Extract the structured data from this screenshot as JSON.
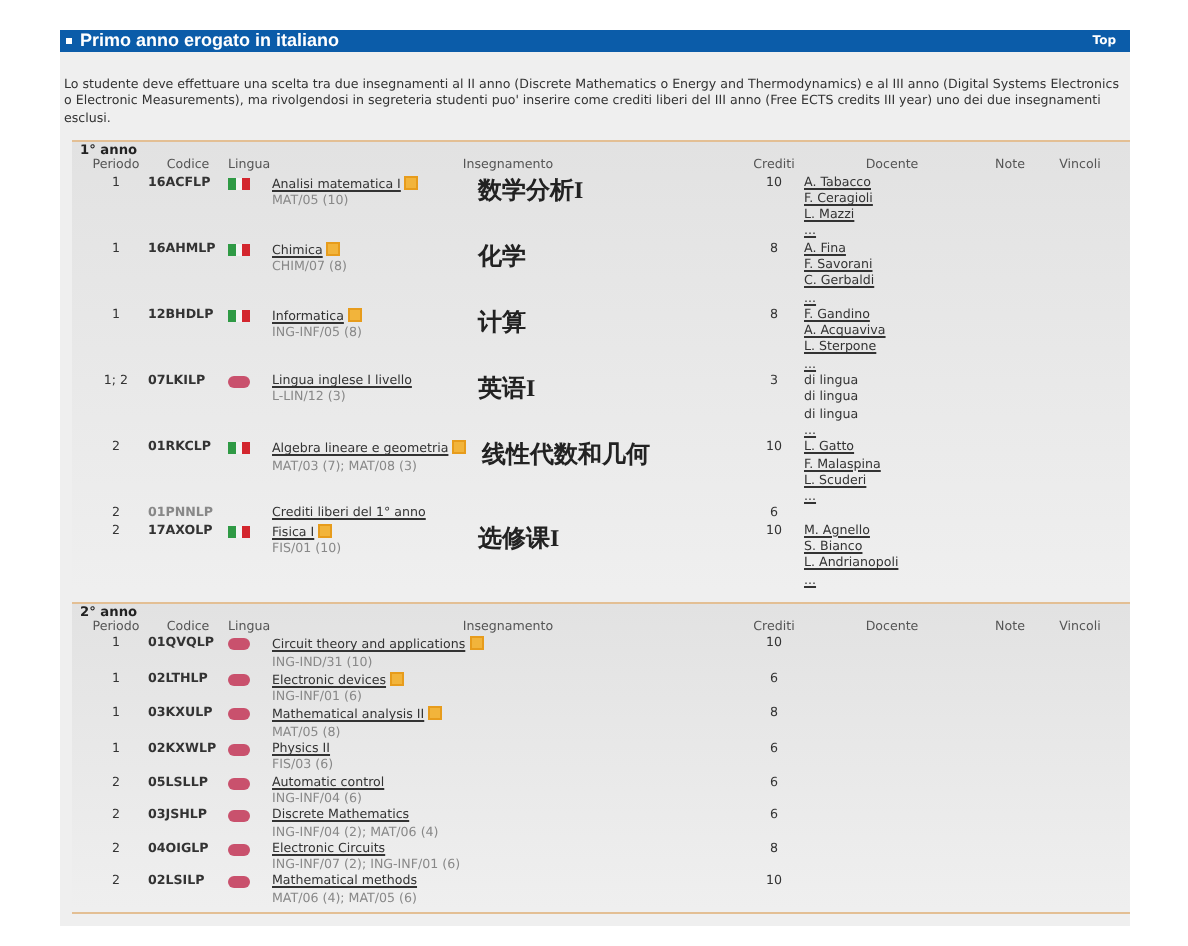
{
  "header": {
    "title": "Primo anno erogato in italiano",
    "top_link": "Top"
  },
  "intro": "Lo studente deve effettuare una scelta tra due insegnamenti al II anno (Discrete Mathematics o Energy and Thermodynamics) e al III anno (Digital Systems Electronics o Electronic Measurements), ma rivolgendosi in segreteria studenti puo' inserire come crediti liberi del III anno (Free ECTS credits III year) uno dei due insegnamenti esclusi.",
  "years": [
    {
      "title": "1° anno",
      "columns": [
        "Periodo",
        "Codice",
        "Lingua",
        "Insegnamento",
        "Crediti",
        "Docente",
        "Note",
        "Vincoli"
      ],
      "rows": [
        {
          "periodo": "1",
          "codice": "16ACFLP",
          "flag": {
            "kind": "it"
          },
          "course": "Analisi matematica I",
          "doc_icon": true,
          "sector": "MAT/05 (10)",
          "note_zh": "数学分析I",
          "crediti": "10",
          "docenti": [
            {
              "text": "A. Tabacco",
              "link": true
            },
            {
              "text": "F. Ceragioli",
              "link": true
            },
            {
              "text": "L. Mazzi",
              "link": true
            },
            {
              "text": "...",
              "link": true
            }
          ]
        },
        {
          "periodo": "1",
          "codice": "16AHMLP",
          "flag": {
            "kind": "it"
          },
          "course": "Chimica",
          "doc_icon": true,
          "sector": "CHIM/07 (8)",
          "note_zh": "化学",
          "crediti": "8",
          "docenti": [
            {
              "text": "A. Fina",
              "link": true
            },
            {
              "text": "F. Savorani",
              "link": true
            },
            {
              "text": "C. Gerbaldi",
              "link": true
            },
            {
              "text": "...",
              "link": true
            }
          ]
        },
        {
          "periodo": "1",
          "codice": "12BHDLP",
          "flag": {
            "kind": "it"
          },
          "course": "Informatica",
          "doc_icon": true,
          "sector": "ING-INF/05 (8)",
          "note_zh": "计算",
          "crediti": "8",
          "docenti": [
            {
              "text": "F. Gandino",
              "link": true
            },
            {
              "text": "A. Acquaviva",
              "link": true
            },
            {
              "text": "L. Sterpone",
              "link": true
            },
            {
              "text": "...",
              "link": true
            }
          ]
        },
        {
          "periodo": "1; 2",
          "codice": "07LKILP",
          "flag": {
            "kind": "en"
          },
          "course": "Lingua inglese I livello",
          "doc_icon": false,
          "sector": "L-LIN/12 (3)",
          "note_zh": "英语I",
          "crediti": "3",
          "docenti": [
            {
              "text": "di lingua",
              "link": false
            },
            {
              "text": "di lingua",
              "link": false
            },
            {
              "text": "di lingua",
              "link": false
            },
            {
              "text": "...",
              "link": true
            }
          ]
        },
        {
          "periodo": "2",
          "codice": "01RKCLP",
          "flag": {
            "kind": "it"
          },
          "course": "Algebra lineare e geometria",
          "doc_icon": true,
          "sector": "MAT/03 (7); MAT/08 (3)",
          "note_zh": "线性代数和几何",
          "crediti": "10",
          "docenti": [
            {
              "text": "L. Gatto",
              "link": true
            },
            {
              "text": "F. Malaspina",
              "link": true
            },
            {
              "text": "L. Scuderi",
              "link": true
            },
            {
              "text": "...",
              "link": true
            }
          ]
        },
        {
          "periodo": "2",
          "codice": "01PNNLP",
          "course": "Crediti liberi del 1° anno",
          "doc_icon": false,
          "crediti": "6",
          "light_code": true
        },
        {
          "periodo": "2",
          "codice": "17AXOLP",
          "flag": {
            "kind": "it"
          },
          "course": "Fisica I",
          "doc_icon": true,
          "sector": "FIS/01 (10)",
          "note_zh": "选修课I",
          "crediti": "10",
          "docenti": [
            {
              "text": "M. Agnello",
              "link": true
            },
            {
              "text": "S. Bianco",
              "link": true
            },
            {
              "text": "L. Andrianopoli",
              "link": true
            },
            {
              "text": "...",
              "link": true
            }
          ]
        }
      ]
    },
    {
      "title": "2° anno",
      "columns": [
        "Periodo",
        "Codice",
        "Lingua",
        "Insegnamento",
        "Crediti",
        "Docente",
        "Note",
        "Vincoli"
      ],
      "rows": [
        {
          "periodo": "1",
          "codice": "01QVQLP",
          "flag": {
            "kind": "en"
          },
          "course": "Circuit theory and applications",
          "doc_icon": true,
          "sector": "ING-IND/31 (10)",
          "crediti": "10"
        },
        {
          "periodo": "1",
          "codice": "02LTHLP",
          "flag": {
            "kind": "en"
          },
          "course": "Electronic devices",
          "doc_icon": true,
          "sector": "ING-INF/01 (6)",
          "crediti": "6"
        },
        {
          "periodo": "1",
          "codice": "03KXULP",
          "flag": {
            "kind": "en"
          },
          "course": "Mathematical analysis II",
          "doc_icon": true,
          "sector": "MAT/05 (8)",
          "crediti": "8"
        },
        {
          "periodo": "1",
          "codice": "02KXWLP",
          "flag": {
            "kind": "en"
          },
          "course": "Physics II",
          "doc_icon": false,
          "sector": "FIS/03 (6)",
          "crediti": "6"
        },
        {
          "periodo": "2",
          "codice": "05LSLLP",
          "flag": {
            "kind": "en"
          },
          "course": "Automatic control",
          "doc_icon": false,
          "sector": "ING-INF/04 (6)",
          "crediti": "6"
        },
        {
          "periodo": "2",
          "codice": "03JSHLP",
          "flag": {
            "kind": "en"
          },
          "course": "Discrete Mathematics",
          "doc_icon": false,
          "sector": "ING-INF/04 (2); MAT/06 (4)",
          "crediti": "6"
        },
        {
          "periodo": "2",
          "codice": "04OIGLP",
          "flag": {
            "kind": "en"
          },
          "course": "Electronic Circuits",
          "doc_icon": false,
          "sector": "ING-INF/07 (2); ING-INF/01 (6)",
          "crediti": "8"
        },
        {
          "periodo": "2",
          "codice": "02LSILP",
          "flag": {
            "kind": "en"
          },
          "course": "Mathematical methods",
          "doc_icon": false,
          "sector": "MAT/06 (4); MAT/05 (6)",
          "crediti": "10"
        }
      ]
    }
  ]
}
